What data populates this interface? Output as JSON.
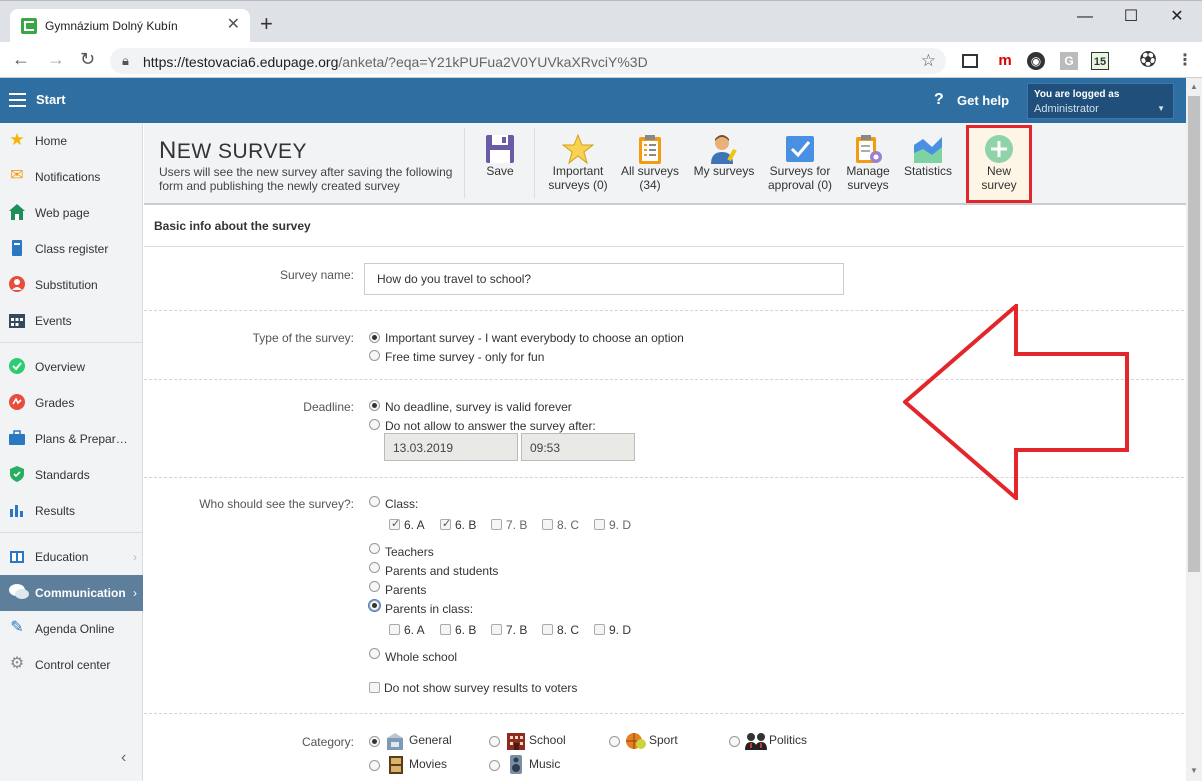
{
  "browser": {
    "tab_title": "Gymnázium Dolný Kubín",
    "tab_close": "✕",
    "new_tab": "+",
    "url_host": "https://testovacia6.edupage.org",
    "url_path": "/anketa/?eqa=Y21kPUFua2V0YUVkaXRvciY%3D",
    "min": "—",
    "max": "☐",
    "close": "✕",
    "ext_15": "15"
  },
  "appbar": {
    "start": "Start",
    "help_q": "?",
    "help": "Get help",
    "logged_as": "You are logged as",
    "user": "Administrator"
  },
  "sidebar": {
    "items": [
      {
        "label": "Home",
        "icon": "home-star-icon"
      },
      {
        "label": "Notifications",
        "icon": "envelope-icon"
      },
      {
        "label": "Web page",
        "icon": "house-icon"
      },
      {
        "label": "Class register",
        "icon": "book-icon"
      },
      {
        "label": "Substitution",
        "icon": "person-icon"
      },
      {
        "label": "Events",
        "icon": "calendar-icon"
      },
      {
        "label": "Overview",
        "icon": "check-circle-icon"
      },
      {
        "label": "Grades",
        "icon": "grades-icon"
      },
      {
        "label": "Plans & Prepar…",
        "icon": "briefcase-icon"
      },
      {
        "label": "Standards",
        "icon": "shield-icon"
      },
      {
        "label": "Results",
        "icon": "bar-chart-icon"
      },
      {
        "label": "Education",
        "icon": "books-icon"
      },
      {
        "label": "Communication",
        "icon": "chat-icon"
      },
      {
        "label": "Agenda Online",
        "icon": "pen-icon"
      },
      {
        "label": "Control center",
        "icon": "gear-icon"
      }
    ]
  },
  "page": {
    "title_cap": "N",
    "title_rest": "EW SURVEY",
    "subtitle": "Users will see the new survey after saving the following form and publishing the newly created survey"
  },
  "toolbar": {
    "save": "Save",
    "important_1": "Important",
    "important_2": "surveys (0)",
    "all_1": "All surveys",
    "all_2": "(34)",
    "my": "My surveys",
    "approval_1": "Surveys for",
    "approval_2": "approval (0)",
    "manage_1": "Manage",
    "manage_2": "surveys",
    "statistics": "Statistics",
    "new_1": "New",
    "new_2": "survey"
  },
  "form": {
    "section": "Basic info about the survey",
    "name_label": "Survey name:",
    "name_value": "How do you travel to school?",
    "type_label": "Type of the survey:",
    "type_opt1": "Important survey - I want everybody to choose an option",
    "type_opt2": "Free time survey - only for fun",
    "deadline_label": "Deadline:",
    "deadline_opt1": "No deadline, survey is valid forever",
    "deadline_opt2": "Do not allow to answer the survey after:",
    "deadline_date": "13.03.2019",
    "deadline_time": "09:53",
    "who_label": "Who should see the survey?:",
    "who_class": "Class:",
    "classes": [
      "6. A",
      "6. B",
      "7. B",
      "8. C",
      "9. D"
    ],
    "who_teachers": "Teachers",
    "who_parents_students": "Parents and students",
    "who_parents": "Parents",
    "who_parents_class": "Parents in class:",
    "who_whole": "Whole school",
    "no_results": "Do not show survey results to voters",
    "category_label": "Category:",
    "cat_general": "General",
    "cat_school": "School",
    "cat_sport": "Sport",
    "cat_politics": "Politics",
    "cat_movies": "Movies",
    "cat_music": "Music"
  }
}
